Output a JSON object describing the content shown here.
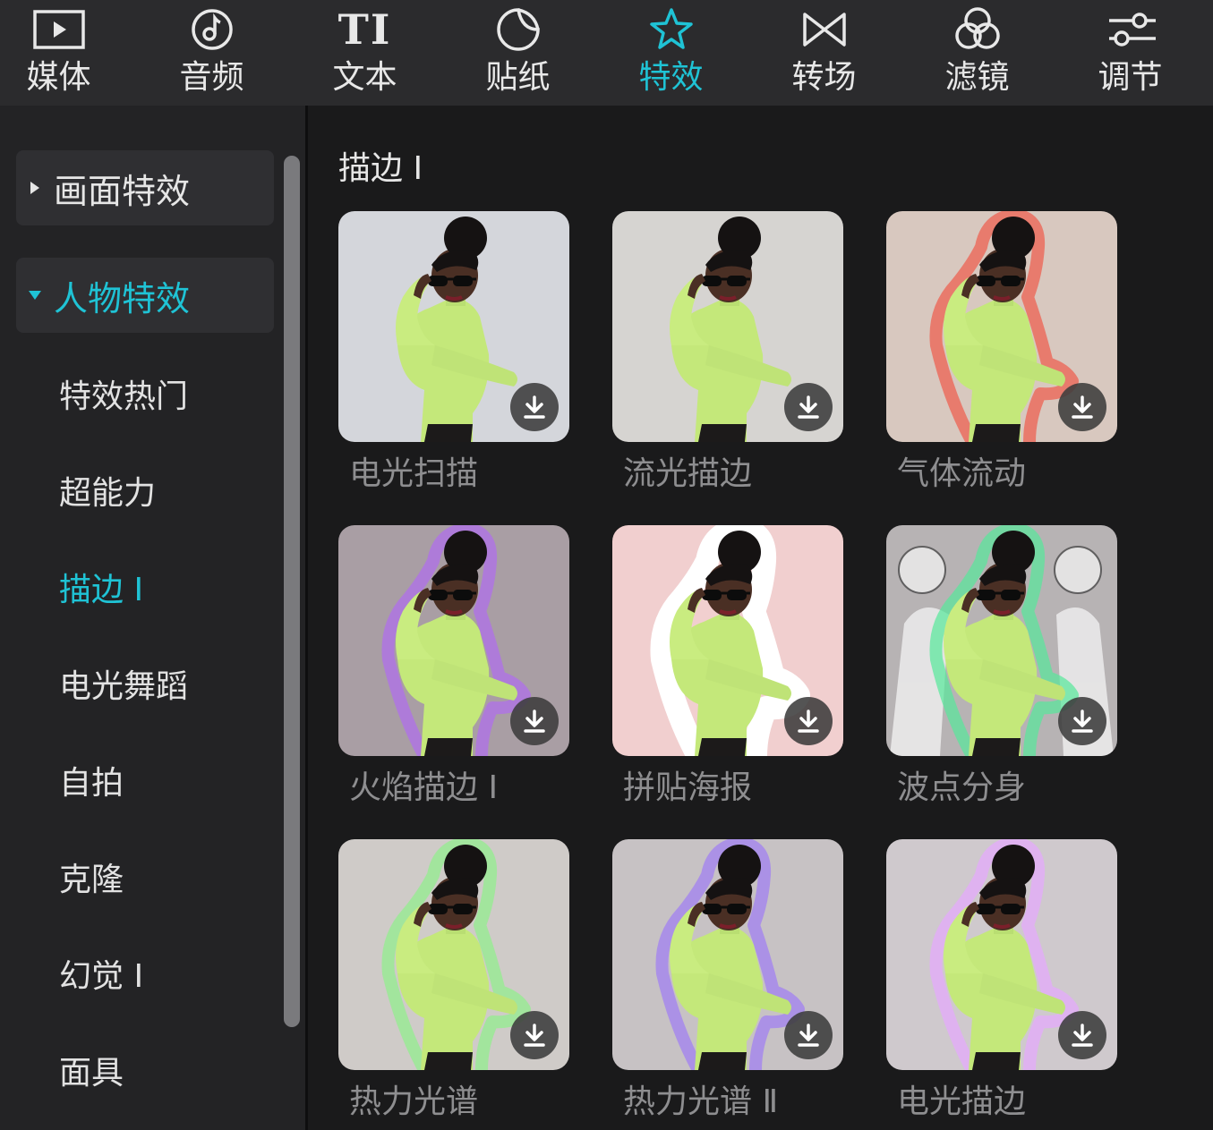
{
  "toolbar": {
    "tabs": [
      {
        "label": "媒体",
        "icon": "media-icon",
        "active": false
      },
      {
        "label": "音频",
        "icon": "audio-icon",
        "active": false
      },
      {
        "label": "文本",
        "icon": "text-icon",
        "active": false
      },
      {
        "label": "贴纸",
        "icon": "sticker-icon",
        "active": false
      },
      {
        "label": "特效",
        "icon": "effects-star-icon",
        "active": true
      },
      {
        "label": "转场",
        "icon": "transition-icon",
        "active": false
      },
      {
        "label": "滤镜",
        "icon": "filter-icon",
        "active": false
      },
      {
        "label": "调节",
        "icon": "adjust-sliders-icon",
        "active": false
      }
    ],
    "text_icon_glyph": "TI"
  },
  "sidebar": {
    "categories": [
      {
        "label": "画面特效",
        "expanded": false
      },
      {
        "label": "人物特效",
        "expanded": true
      }
    ],
    "subitems": [
      {
        "label": "特效热门",
        "active": false
      },
      {
        "label": "超能力",
        "active": false
      },
      {
        "label": "描边 I",
        "active": true
      },
      {
        "label": "电光舞蹈",
        "active": false
      },
      {
        "label": "自拍",
        "active": false
      },
      {
        "label": "克隆",
        "active": false
      },
      {
        "label": "幻觉 Ⅰ",
        "active": false
      },
      {
        "label": "面具",
        "active": false
      }
    ]
  },
  "content": {
    "section_title": "描边 I",
    "effects": [
      {
        "label": "电光扫描",
        "bg": "#d4d6db",
        "glow": "scan"
      },
      {
        "label": "流光描边",
        "bg": "#d6d4d1",
        "glow": "none"
      },
      {
        "label": "气体流动",
        "bg": "#d8c8bf",
        "glow": "#f05a4a"
      },
      {
        "label": "火焰描边 I",
        "bg": "#a99ea4",
        "glow": "#b06cf0"
      },
      {
        "label": "拼贴海报",
        "bg": "#f1cfcf",
        "glow": "#ffffff"
      },
      {
        "label": "波点分身",
        "bg": "#b7b3b4",
        "glow": "#56e89a"
      },
      {
        "label": "热力光谱",
        "bg": "#cfcbc8",
        "glow": "#8ef08a"
      },
      {
        "label": "热力光谱 Ⅱ",
        "bg": "#c7c2c4",
        "glow": "#a07cf5"
      },
      {
        "label": "电光描边",
        "bg": "#cfc9cd",
        "glow": "#e6a8ff"
      }
    ]
  },
  "colors": {
    "accent": "#1fc3d5",
    "toolbar_bg": "#2b2b2d",
    "sidebar_bg": "#232325",
    "content_bg": "#1a1a1b",
    "label_muted": "#8e8e90"
  }
}
